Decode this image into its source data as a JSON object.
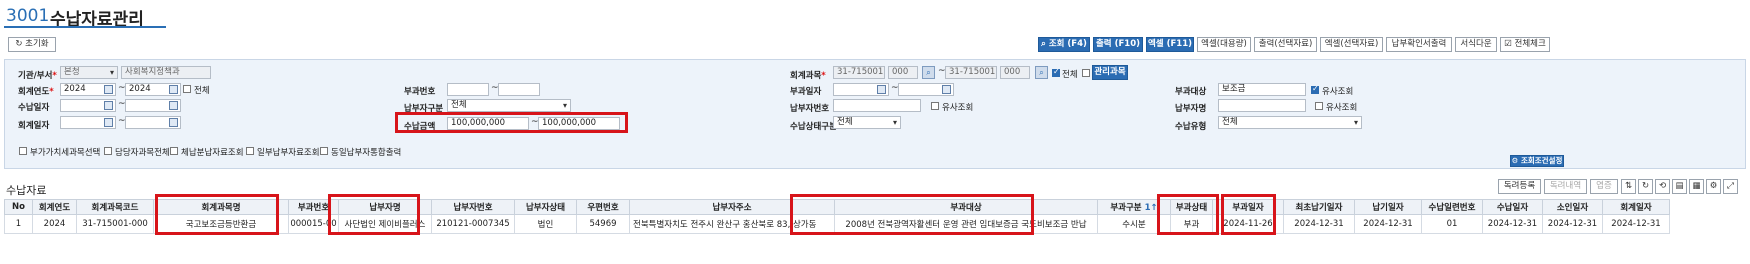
{
  "page": {
    "code": "3001",
    "title": "수납자료관리"
  },
  "toolbar": {
    "reset": "초기화",
    "search": "조회 (F4)",
    "print": "출력 (F10)",
    "excel": "엑셀 (F11)",
    "excel_large": "엑셀(대용량)",
    "print_selected": "출력(선택자료)",
    "excel_selected": "엑셀(선택자료)",
    "payment_confirm_print": "납부확인서출력",
    "format_download": "서식다운",
    "check_all": "전체체크"
  },
  "filters": {
    "org_label": "기관/부서",
    "org_branch": "본청",
    "org_dept": "사회복지정책과",
    "fiscal_year_label": "회계연도",
    "fiscal_year_from": "2024",
    "fiscal_year_to": "2024",
    "fiscal_year_all": "전체",
    "receipt_date_label": "수납일자",
    "account_date_label": "회계일자",
    "levy_no_label": "부과번호",
    "payer_type_label": "납부자구분",
    "payer_type_value": "전체",
    "receipt_amount_label": "수납금액",
    "receipt_amount_from": "100,000,000",
    "receipt_amount_to": "100,000,000",
    "account_subject_label": "회계과목",
    "account_subject_from": "31-715001",
    "account_subject_from_sub": "000",
    "account_subject_to": "31-715001",
    "account_subject_to_sub": "000",
    "account_subject_all": "전체",
    "manage_subject_button": "관리과목",
    "levy_date_label": "부과일자",
    "payer_no_label": "납부자번호",
    "similar_search": "유사조회",
    "receipt_status_label": "수납상태구분",
    "receipt_status_value": "전체",
    "levy_target_label": "부과대상",
    "levy_target_value": "보조금",
    "payer_name_label": "납부자명",
    "receipt_type_label": "수납유형",
    "receipt_type_value": "전체",
    "opt_vat": "부가가치세과목선택",
    "opt_owner_all": "담당자과목전체",
    "opt_arrears": "체납분납자료조회",
    "opt_partial": "일부납부자료조회",
    "opt_same_payer": "동일납부자통합출력",
    "condition_settings": "조회조건설정"
  },
  "grid": {
    "section_title": "수납자료",
    "actions": {
      "register": "독려등록",
      "history": "독려내역",
      "save": "엽증"
    },
    "columns": [
      "No",
      "회계연도",
      "회계과목코드",
      "회계과목명",
      "부과번호",
      "납부자명",
      "납부자번호",
      "납부자상태",
      "우편번호",
      "납부자주소",
      "부과대상",
      "부과구분",
      "부과상태",
      "부과일자",
      "최초납기일자",
      "납기일자",
      "수납일련번호",
      "수납일자",
      "소인일자",
      "회계일자"
    ],
    "sort_indicator": "1↑",
    "rows": [
      [
        "1",
        "2024",
        "31-715001-000",
        "국고보조금등반환금",
        "000015-00",
        "사단법인 제이비플러스",
        "210121-0007345",
        "법인",
        "54969",
        "전북특별자치도 전주시 완산구 홍산북로 83, 상가동",
        "2008년 전북광역자활센터 운영 관련 임대보증금 국도비보조금 반납",
        "수시분",
        "부과",
        "2024-11-26",
        "2024-12-31",
        "2024-12-31",
        "01",
        "2024-12-31",
        "2024-12-31",
        "2024-12-31"
      ]
    ]
  }
}
